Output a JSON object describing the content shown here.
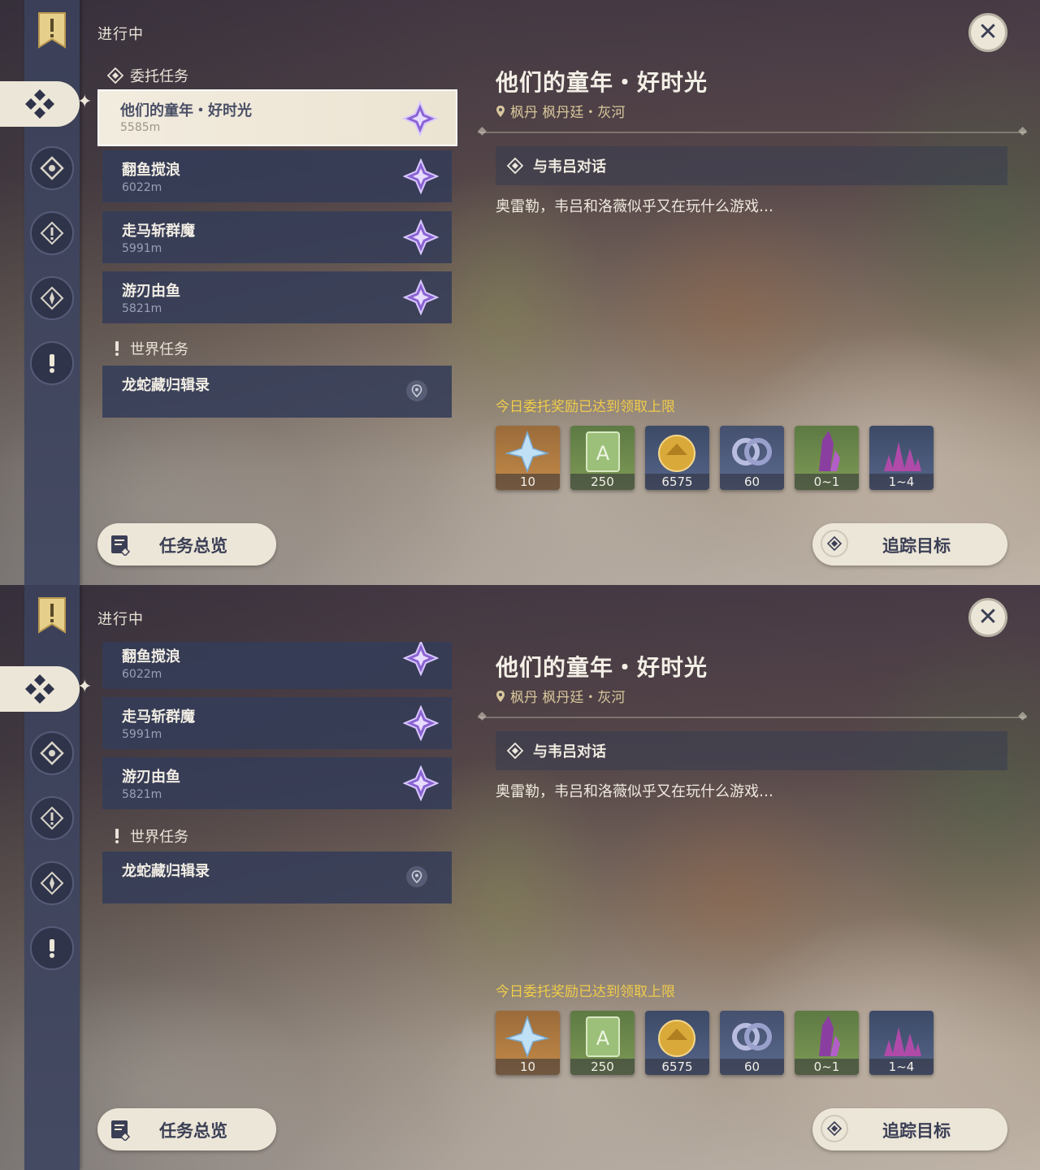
{
  "header": {
    "section_label": "进行中"
  },
  "categories": {
    "commission": "委托任务",
    "world": "世界任务"
  },
  "quests": [
    {
      "title": "他们的童年・好时光",
      "distance": "5585m",
      "type": "commission"
    },
    {
      "title": "翻鱼搅浪",
      "distance": "6022m",
      "type": "commission"
    },
    {
      "title": "走马斩群魔",
      "distance": "5991m",
      "type": "commission"
    },
    {
      "title": "游刃由鱼",
      "distance": "5821m",
      "type": "commission"
    },
    {
      "title": "龙蛇藏归辑录",
      "distance": "",
      "type": "world"
    }
  ],
  "detail": {
    "title": "他们的童年・好时光",
    "location": "枫丹 枫丹廷・灰河",
    "objective": "与韦吕对话",
    "description": "奥雷勒，韦吕和洛薇似乎又在玩什么游戏…",
    "reward_limit": "今日委托奖励已达到领取上限",
    "rewards": [
      {
        "icon": "primogem-icon",
        "count": "10"
      },
      {
        "icon": "adventure-exp-icon",
        "count": "250"
      },
      {
        "icon": "mora-icon",
        "count": "6575"
      },
      {
        "icon": "companionship-exp-icon",
        "count": "60"
      },
      {
        "icon": "crystal-chunk-icon",
        "count": "0~1"
      },
      {
        "icon": "crystal-cluster-icon",
        "count": "1~4"
      }
    ]
  },
  "buttons": {
    "overview": "任务总览",
    "track": "追踪目标",
    "close": "✕"
  },
  "scroll_state": {
    "panel_top": "top",
    "panel_bottom": "scrolled"
  },
  "colors": {
    "accent_gold": "#f0cc4a",
    "location_gold": "#d9c79c",
    "card_bg": "#343c58",
    "selected_bg": "#ece6d8",
    "commission_purple": "#8a63d2"
  }
}
